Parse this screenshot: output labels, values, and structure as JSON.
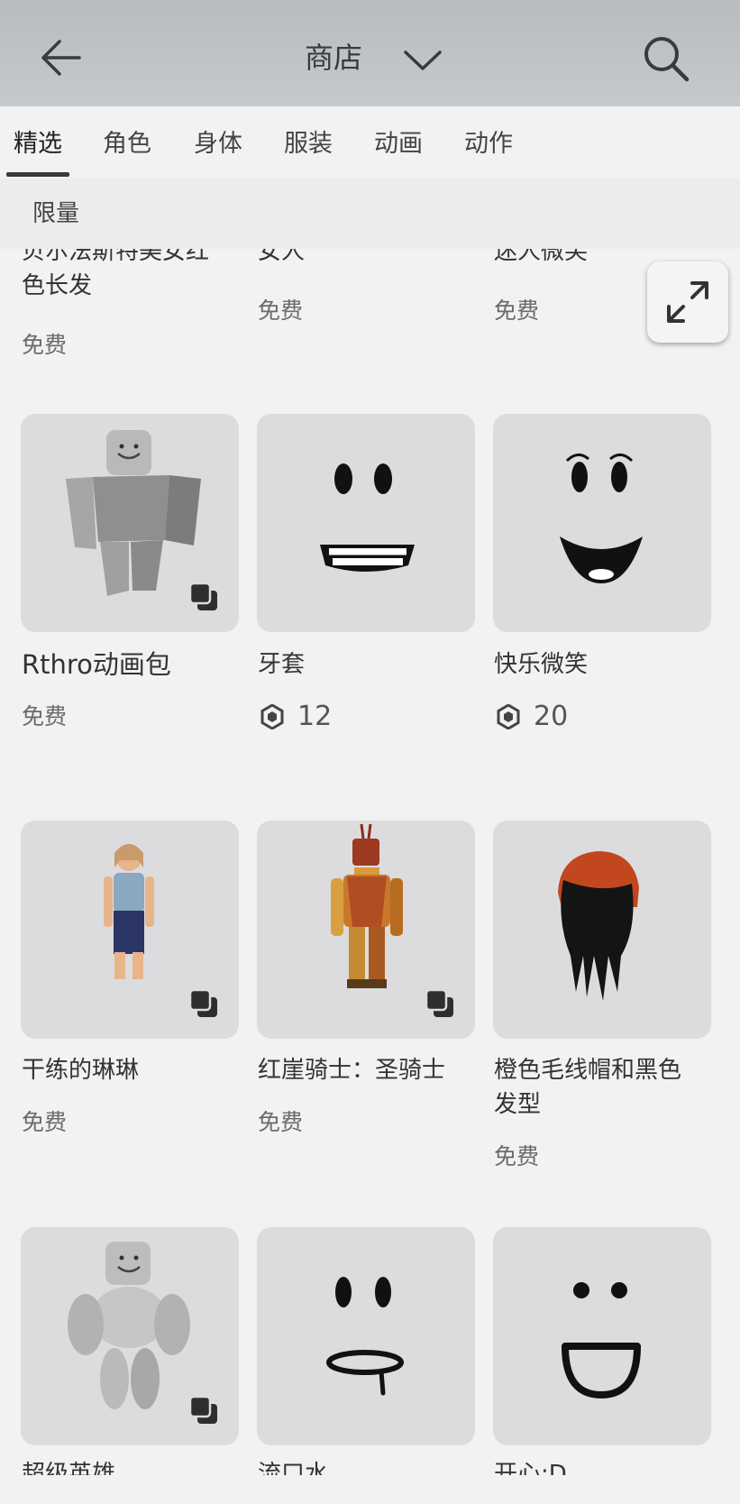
{
  "header": {
    "title": "商店"
  },
  "tabs": [
    {
      "label": "精选"
    },
    {
      "label": "角色"
    },
    {
      "label": "身体"
    },
    {
      "label": "服装"
    },
    {
      "label": "动画"
    },
    {
      "label": "动作"
    }
  ],
  "subtabs": [
    {
      "label": "限量"
    }
  ],
  "items": [
    {
      "name": "贝尔法斯特美女红色长发",
      "price": "免费"
    },
    {
      "name": "女人",
      "price": "免费"
    },
    {
      "name": "迷人微笑",
      "price": "免费"
    },
    {
      "name": "Rthro动画包",
      "price": "免费"
    },
    {
      "name": "牙套",
      "price": "12"
    },
    {
      "name": "快乐微笑",
      "price": "20"
    },
    {
      "name": "干练的琳琳",
      "price": "免费"
    },
    {
      "name": "红崖骑士：圣骑士",
      "price": "免费"
    },
    {
      "name": "橙色毛线帽和黑色发型",
      "price": "免费"
    },
    {
      "name": "超级英雄",
      "price": ""
    },
    {
      "name": "流口水",
      "price": ""
    },
    {
      "name": "开心:D",
      "price": ""
    }
  ],
  "icons": {
    "back": "arrow-left-icon",
    "dropdown": "chevron-down-icon",
    "search": "search-icon",
    "expand": "expand-icon",
    "robux": "robux-icon",
    "bundle": "bundle-icon"
  },
  "colors": {
    "header_bg": "#bdc0c3",
    "page_bg": "#f2f2f3",
    "thumb_bg": "#dcdcdf",
    "text": "#333333",
    "muted": "#6b6b6b"
  }
}
